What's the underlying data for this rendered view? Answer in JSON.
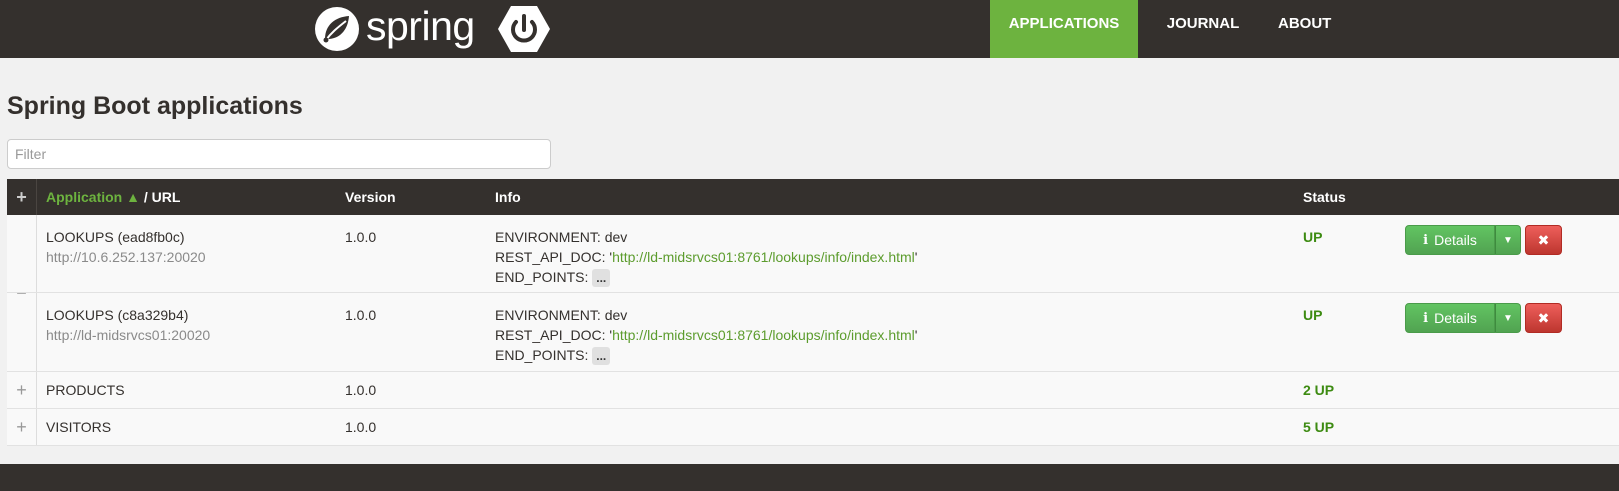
{
  "brand": {
    "logo_text": "spring"
  },
  "nav": {
    "items": [
      "APPLICATIONS",
      "JOURNAL",
      "ABOUT"
    ]
  },
  "page": {
    "title": "Spring Boot applications"
  },
  "filter": {
    "placeholder": "Filter"
  },
  "table": {
    "header": {
      "toggle": "+",
      "application": "Application ▲",
      "url": " / URL",
      "version": "Version",
      "info": "Info",
      "status": "Status"
    },
    "expanded_group": {
      "toggle": "−",
      "rows": [
        {
          "name": "LOOKUPS (ead8fb0c)",
          "url": "http://10.6.252.137:20020",
          "version": "1.0.0",
          "info_env_label": "ENVIRONMENT:",
          "info_env_value": "dev",
          "info_rest_label": "REST_API_DOC:",
          "info_rest_open": "'",
          "info_rest_link": "http://ld-midsrvcs01:8761/lookups/info/index.html",
          "info_rest_close": "'",
          "info_endpoints_label": "END_POINTS:",
          "info_endpoints_value": "...",
          "status": "UP",
          "details_label": "Details",
          "remove_glyph": "✖"
        },
        {
          "name": "LOOKUPS (c8a329b4)",
          "url": "http://ld-midsrvcs01:20020",
          "version": "1.0.0",
          "info_env_label": "ENVIRONMENT:",
          "info_env_value": "dev",
          "info_rest_label": "REST_API_DOC:",
          "info_rest_open": "'",
          "info_rest_link": "http://ld-midsrvcs01:8761/lookups/info/index.html",
          "info_rest_close": "'",
          "info_endpoints_label": "END_POINTS:",
          "info_endpoints_value": "...",
          "status": "UP",
          "details_label": "Details",
          "remove_glyph": "✖"
        }
      ]
    },
    "collapsed_groups": [
      {
        "toggle": "+",
        "name": "PRODUCTS",
        "version": "1.0.0",
        "status": "2 UP"
      },
      {
        "toggle": "+",
        "name": "VISITORS",
        "version": "1.0.0",
        "status": "5 UP"
      }
    ]
  },
  "colors": {
    "brand_green": "#6db33f",
    "dark": "#34302d",
    "status_green": "#3d8b12",
    "danger": "#bd362f"
  }
}
